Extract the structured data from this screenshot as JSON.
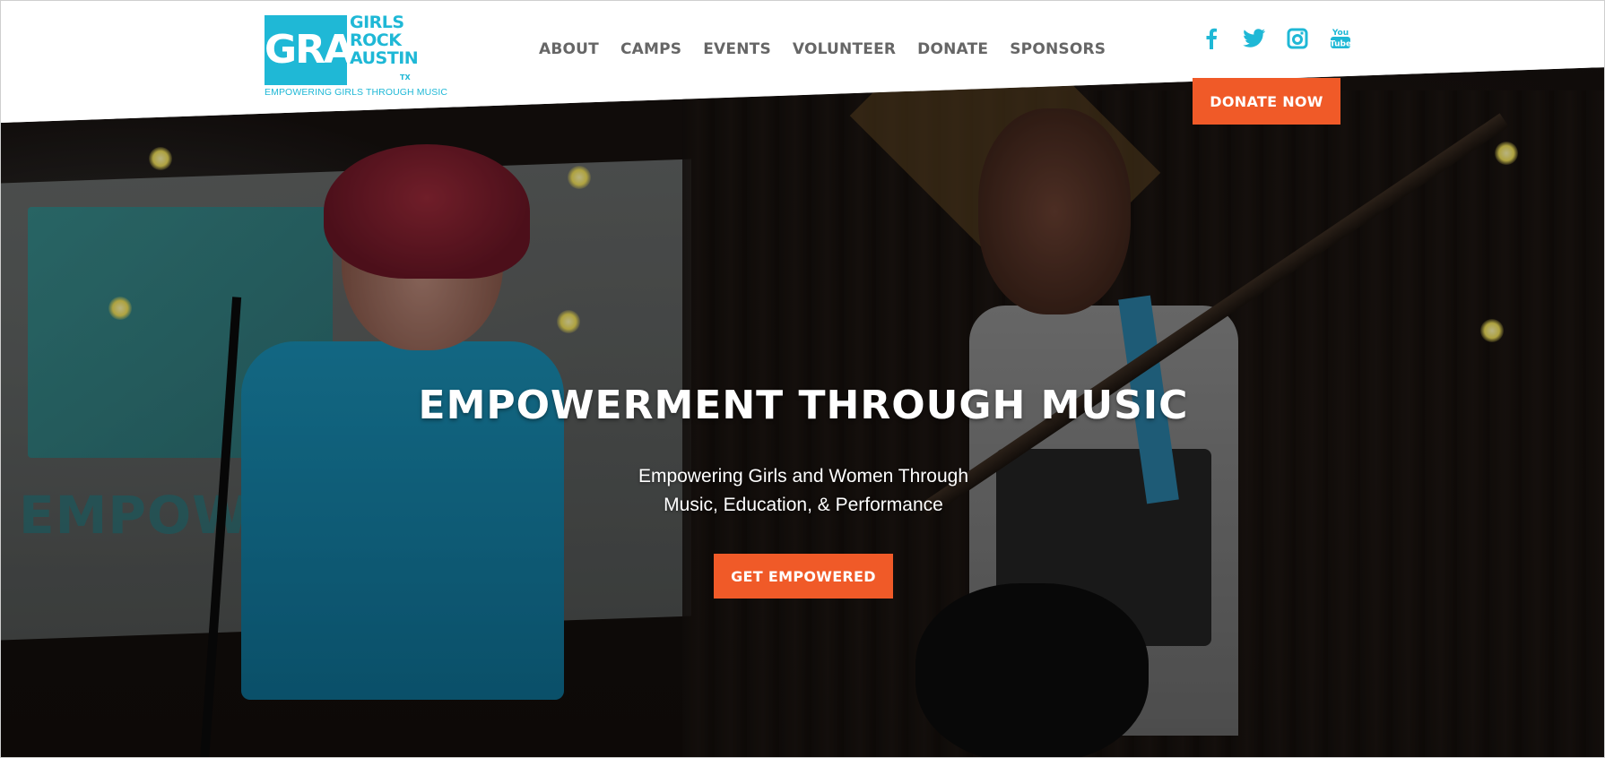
{
  "header": {
    "logo": {
      "mark": "GRA",
      "words": [
        "GIRLS",
        "ROCK",
        "AUSTIN"
      ],
      "state": "TX",
      "tagline": "EMPOWERING GIRLS THROUGH MUSIC"
    },
    "nav": [
      "ABOUT",
      "CAMPS",
      "EVENTS",
      "VOLUNTEER",
      "DONATE",
      "SPONSORS"
    ],
    "social": [
      "facebook-icon",
      "twitter-icon",
      "instagram-icon",
      "youtube-icon"
    ],
    "youtube_label": "You Tube",
    "donate_label": "DONATE NOW"
  },
  "hero": {
    "title": "EMPOWERMENT THROUGH MUSIC",
    "subtitle_line1": "Empowering Girls and Women Through",
    "subtitle_line2": "Music, Education, & Performance",
    "cta_label": "GET EMPOWERED",
    "banner_text": "EMPOWERING"
  },
  "colors": {
    "accent_orange": "#f05a28",
    "brand_blue": "#1fb8d6",
    "nav_text": "#666666"
  }
}
